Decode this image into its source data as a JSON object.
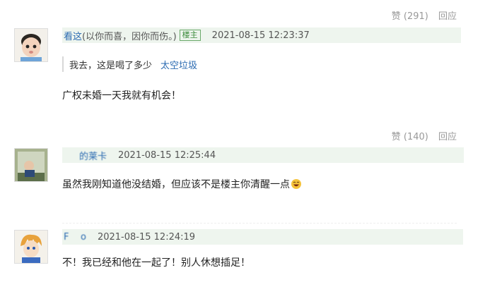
{
  "comments": [
    {
      "likes": "赞 (291)",
      "reply": "回应",
      "author": "看这",
      "author_suffix": "(以你而喜，因你而伤。)",
      "op_badge": "楼主",
      "time": "2021-08-15 12:23:37",
      "quote_text": "我去，这是喝了多少",
      "quote_author": "太空垃圾",
      "body": "广权未婚一天我就有机会！"
    },
    {
      "likes": "赞 (140)",
      "reply": "回应",
      "author": "的莱卡",
      "time": "2021-08-15 12:25:44",
      "body": "虽然我刚知道他没结婚，但应该不是楼主你清醒一点"
    },
    {
      "author": "F    o",
      "time": "2021-08-15 12:24:19",
      "body": "不！我已经和他在一起了！别人休想插足！"
    }
  ],
  "colors": {
    "link": "#2a6ab1",
    "bar_bg": "#eef5ee",
    "badge": "#3a8a3a"
  }
}
